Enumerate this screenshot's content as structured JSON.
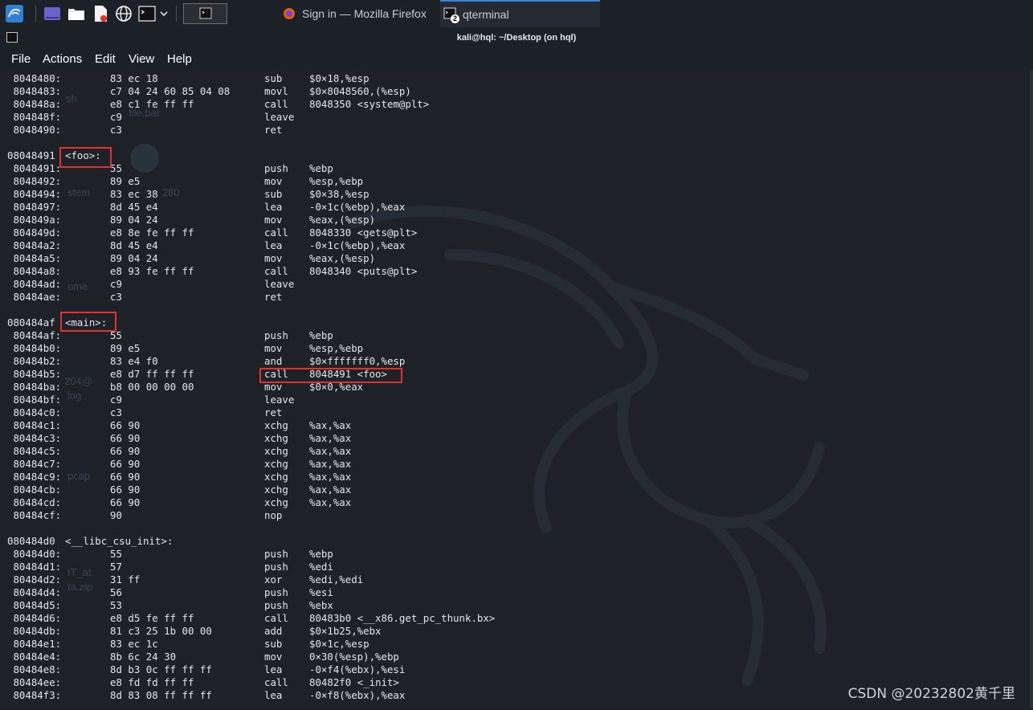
{
  "taskbar": {
    "tasks": [
      {
        "label": "Sign in — Mozilla Firefox",
        "icon": "firefox-icon"
      },
      {
        "label": "qterminal",
        "icon": "terminal-icon",
        "badge": "2"
      }
    ]
  },
  "window": {
    "title": "kali@hql: ~/Desktop (on hql)"
  },
  "menu": [
    "File",
    "Actions",
    "Edit",
    "View",
    "Help"
  ],
  "desktop_ghost_labels": [
    "sh",
    "file.bar",
    "stem",
    "280",
    "ome",
    "204@",
    "log",
    "pcap",
    "IT_at",
    "ta.zip"
  ],
  "disassembly": [
    {
      "addr": " 8048480:",
      "bytes": "83 ec 18",
      "mn": "sub",
      "ops": "$0×18,%esp"
    },
    {
      "addr": " 8048483:",
      "bytes": "c7 04 24 60 85 04 08",
      "mn": "movl",
      "ops": "$0×8048560,(%esp)"
    },
    {
      "addr": " 804848a:",
      "bytes": "e8 c1 fe ff ff",
      "mn": "call",
      "ops": "8048350 <system@plt>"
    },
    {
      "addr": " 804848f:",
      "bytes": "c9",
      "mn": "leave",
      "ops": ""
    },
    {
      "addr": " 8048490:",
      "bytes": "c3",
      "mn": "ret",
      "ops": ""
    },
    {
      "blank": true
    },
    {
      "func": "08048491",
      "label": "<foo>:"
    },
    {
      "addr": " 8048491:",
      "bytes": "55",
      "mn": "push",
      "ops": "%ebp"
    },
    {
      "addr": " 8048492:",
      "bytes": "89 e5",
      "mn": "mov",
      "ops": "%esp,%ebp"
    },
    {
      "addr": " 8048494:",
      "bytes": "83 ec 38",
      "mn": "sub",
      "ops": "$0×38,%esp"
    },
    {
      "addr": " 8048497:",
      "bytes": "8d 45 e4",
      "mn": "lea",
      "ops": "-0×1c(%ebp),%eax"
    },
    {
      "addr": " 804849a:",
      "bytes": "89 04 24",
      "mn": "mov",
      "ops": "%eax,(%esp)"
    },
    {
      "addr": " 804849d:",
      "bytes": "e8 8e fe ff ff",
      "mn": "call",
      "ops": "8048330 <gets@plt>"
    },
    {
      "addr": " 80484a2:",
      "bytes": "8d 45 e4",
      "mn": "lea",
      "ops": "-0×1c(%ebp),%eax"
    },
    {
      "addr": " 80484a5:",
      "bytes": "89 04 24",
      "mn": "mov",
      "ops": "%eax,(%esp)"
    },
    {
      "addr": " 80484a8:",
      "bytes": "e8 93 fe ff ff",
      "mn": "call",
      "ops": "8048340 <puts@plt>"
    },
    {
      "addr": " 80484ad:",
      "bytes": "c9",
      "mn": "leave",
      "ops": ""
    },
    {
      "addr": " 80484ae:",
      "bytes": "c3",
      "mn": "ret",
      "ops": ""
    },
    {
      "blank": true
    },
    {
      "func": "080484af",
      "label": "<main>:"
    },
    {
      "addr": " 80484af:",
      "bytes": "55",
      "mn": "push",
      "ops": "%ebp"
    },
    {
      "addr": " 80484b0:",
      "bytes": "89 e5",
      "mn": "mov",
      "ops": "%esp,%ebp"
    },
    {
      "addr": " 80484b2:",
      "bytes": "83 e4 f0",
      "mn": "and",
      "ops": "$0×fffffff0,%esp"
    },
    {
      "addr": " 80484b5:",
      "bytes": "e8 d7 ff ff ff",
      "mn": "call",
      "ops": "8048491 <foo>"
    },
    {
      "addr": " 80484ba:",
      "bytes": "b8 00 00 00 00",
      "mn": "mov",
      "ops": "$0×0,%eax"
    },
    {
      "addr": " 80484bf:",
      "bytes": "c9",
      "mn": "leave",
      "ops": ""
    },
    {
      "addr": " 80484c0:",
      "bytes": "c3",
      "mn": "ret",
      "ops": ""
    },
    {
      "addr": " 80484c1:",
      "bytes": "66 90",
      "mn": "xchg",
      "ops": "%ax,%ax"
    },
    {
      "addr": " 80484c3:",
      "bytes": "66 90",
      "mn": "xchg",
      "ops": "%ax,%ax"
    },
    {
      "addr": " 80484c5:",
      "bytes": "66 90",
      "mn": "xchg",
      "ops": "%ax,%ax"
    },
    {
      "addr": " 80484c7:",
      "bytes": "66 90",
      "mn": "xchg",
      "ops": "%ax,%ax"
    },
    {
      "addr": " 80484c9:",
      "bytes": "66 90",
      "mn": "xchg",
      "ops": "%ax,%ax"
    },
    {
      "addr": " 80484cb:",
      "bytes": "66 90",
      "mn": "xchg",
      "ops": "%ax,%ax"
    },
    {
      "addr": " 80484cd:",
      "bytes": "66 90",
      "mn": "xchg",
      "ops": "%ax,%ax"
    },
    {
      "addr": " 80484cf:",
      "bytes": "90",
      "mn": "nop",
      "ops": ""
    },
    {
      "blank": true
    },
    {
      "func": "080484d0",
      "label": "<__libc_csu_init>:"
    },
    {
      "addr": " 80484d0:",
      "bytes": "55",
      "mn": "push",
      "ops": "%ebp"
    },
    {
      "addr": " 80484d1:",
      "bytes": "57",
      "mn": "push",
      "ops": "%edi"
    },
    {
      "addr": " 80484d2:",
      "bytes": "31 ff",
      "mn": "xor",
      "ops": "%edi,%edi"
    },
    {
      "addr": " 80484d4:",
      "bytes": "56",
      "mn": "push",
      "ops": "%esi"
    },
    {
      "addr": " 80484d5:",
      "bytes": "53",
      "mn": "push",
      "ops": "%ebx"
    },
    {
      "addr": " 80484d6:",
      "bytes": "e8 d5 fe ff ff",
      "mn": "call",
      "ops": "80483b0 <__x86.get_pc_thunk.bx>"
    },
    {
      "addr": " 80484db:",
      "bytes": "81 c3 25 1b 00 00",
      "mn": "add",
      "ops": "$0×1b25,%ebx"
    },
    {
      "addr": " 80484e1:",
      "bytes": "83 ec 1c",
      "mn": "sub",
      "ops": "$0×1c,%esp"
    },
    {
      "addr": " 80484e4:",
      "bytes": "8b 6c 24 30",
      "mn": "mov",
      "ops": "0×30(%esp),%ebp"
    },
    {
      "addr": " 80484e8:",
      "bytes": "8d b3 0c ff ff ff",
      "mn": "lea",
      "ops": "-0×f4(%ebx),%esi"
    },
    {
      "addr": " 80484ee:",
      "bytes": "e8 fd fd ff ff",
      "mn": "call",
      "ops": "80482f0 <_init>"
    },
    {
      "addr": " 80484f3:",
      "bytes": "8d 83 08 ff ff ff",
      "mn": "lea",
      "ops": "-0×f8(%ebx),%eax"
    }
  ],
  "watermark": "CSDN @20232802黄千里",
  "colors": {
    "highlight": "#e0332e",
    "terminal_bg": "#1e2228",
    "text": "#e3e6ea",
    "accent": "#3b82d6"
  }
}
